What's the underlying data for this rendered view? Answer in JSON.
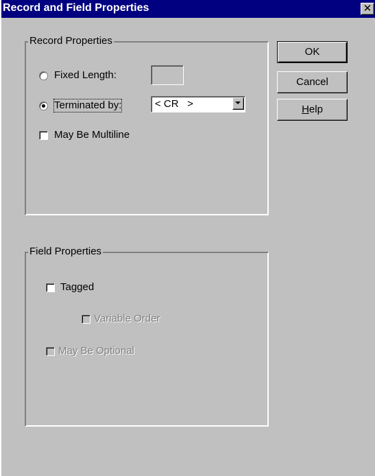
{
  "window": {
    "title": "Record and Field Properties",
    "close_glyph": "✕"
  },
  "record_group": {
    "label": "Record Properties",
    "fixed_length_label": "Fixed Length:",
    "fixed_length_value": "",
    "fixed_length_selected": false,
    "terminated_by_label": "Terminated by:",
    "terminated_by_selected": true,
    "terminator_value": "< CR   >",
    "may_be_multiline_label": "May Be Multiline",
    "may_be_multiline_checked": false
  },
  "field_group": {
    "label": "Field Properties",
    "tagged_label": "Tagged",
    "tagged_checked": false,
    "variable_order_label": "Variable Order",
    "variable_order_enabled": false,
    "may_be_optional_label": "May Be Optional",
    "may_be_optional_enabled": false
  },
  "buttons": {
    "ok_label": "OK",
    "cancel_label": "Cancel",
    "help_label_prefix": "",
    "help_label_underlined": "H",
    "help_label_rest": "elp"
  },
  "icons": {
    "close": "close-icon",
    "dropdown": "chevron-down-icon"
  },
  "colors": {
    "titlebar": "#000080",
    "face": "#c0c0c0",
    "disabled_text": "#808080"
  }
}
